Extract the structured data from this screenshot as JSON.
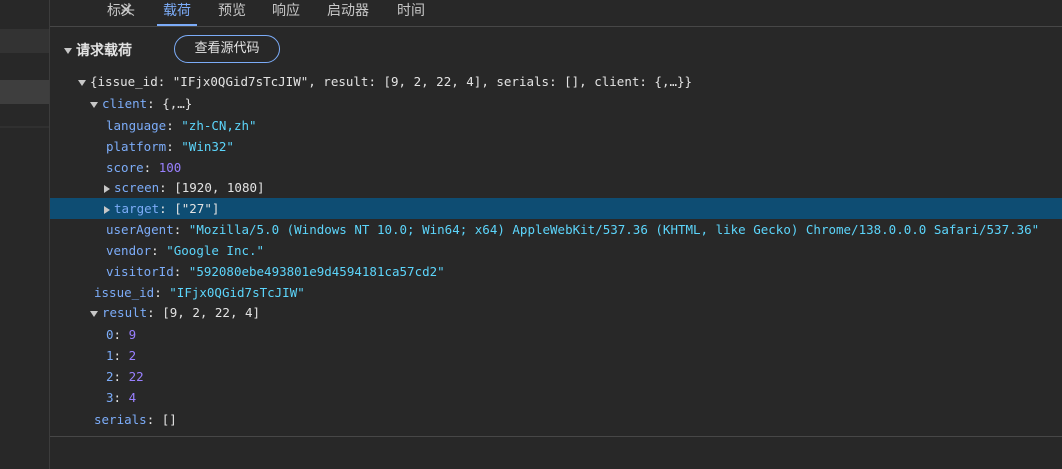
{
  "tabs": {
    "close": "✕",
    "items": [
      "标头",
      "载荷",
      "预览",
      "响应",
      "启动器",
      "时间"
    ],
    "active_index": 1
  },
  "section": {
    "title": "请求载荷",
    "view_source_label": "查看源代码"
  },
  "tree": {
    "root_summary": "{issue_id: \"IFjx0QGid7sTcJIW\", result: [9, 2, 22, 4], serials: [], client: {,…}}",
    "client": {
      "key": "client",
      "summary": "{,…}",
      "language": {
        "key": "language",
        "value": "\"zh-CN,zh\""
      },
      "platform": {
        "key": "platform",
        "value": "\"Win32\""
      },
      "score": {
        "key": "score",
        "value": "100"
      },
      "screen": {
        "key": "screen",
        "value": "[1920, 1080]"
      },
      "target": {
        "key": "target",
        "value": "[\"27\"]"
      },
      "userAgent": {
        "key": "userAgent",
        "value": "\"Mozilla/5.0 (Windows NT 10.0; Win64; x64) AppleWebKit/537.36 (KHTML, like Gecko) Chrome/138.0.0.0 Safari/537.36\""
      },
      "vendor": {
        "key": "vendor",
        "value": "\"Google Inc.\""
      },
      "visitorId": {
        "key": "visitorId",
        "value": "\"592080ebe493801e9d4594181ca57cd2\""
      }
    },
    "issue_id": {
      "key": "issue_id",
      "value": "\"IFjx0QGid7sTcJIW\""
    },
    "result": {
      "key": "result",
      "summary": "[9, 2, 22, 4]",
      "items": [
        {
          "key": "0",
          "value": "9"
        },
        {
          "key": "1",
          "value": "2"
        },
        {
          "key": "2",
          "value": "22"
        },
        {
          "key": "3",
          "value": "4"
        }
      ]
    },
    "serials": {
      "key": "serials",
      "value": "[]"
    }
  },
  "colors": {
    "accent": "#7cacf8",
    "selected_row": "#0e4d73",
    "string": "#5cd5fb",
    "number": "#9980ff"
  }
}
